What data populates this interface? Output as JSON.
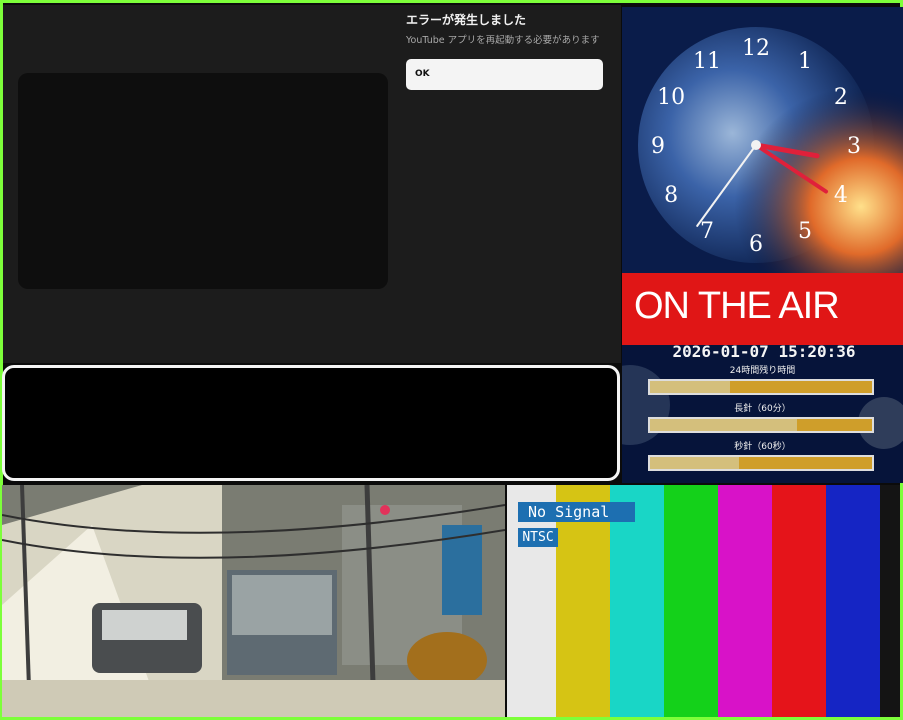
{
  "youtube_dialog": {
    "title": "エラーが発生しました",
    "message": "YouTube アプリを再起動する必要があります",
    "ok_label": "OK"
  },
  "clock": {
    "numerals": [
      "12",
      "1",
      "2",
      "3",
      "4",
      "5",
      "6",
      "7",
      "8",
      "9",
      "10",
      "11"
    ],
    "on_air": "ON THE AIR",
    "datetime": "2026-01-07 15:20:36",
    "meters": [
      {
        "label": "24時間残り時間",
        "fraction": 0.36
      },
      {
        "label": "長針（60分）",
        "fraction": 0.66
      },
      {
        "label": "秒針（60秒）",
        "fraction": 0.4
      }
    ],
    "colors": {
      "on_air_bg": "#e01616",
      "bar_bg": "#cf9e2a",
      "bar_fill": "#d4bf7c"
    }
  },
  "test_signal": {
    "no_signal": "No Signal",
    "standard": "NTSC",
    "bar_colors": [
      "#e8e8e8",
      "#d6c414",
      "#19d6c6",
      "#14d11a",
      "#d812c8",
      "#e5141a",
      "#1525c4",
      "#141414"
    ]
  },
  "frame_color": "#7dff3a"
}
